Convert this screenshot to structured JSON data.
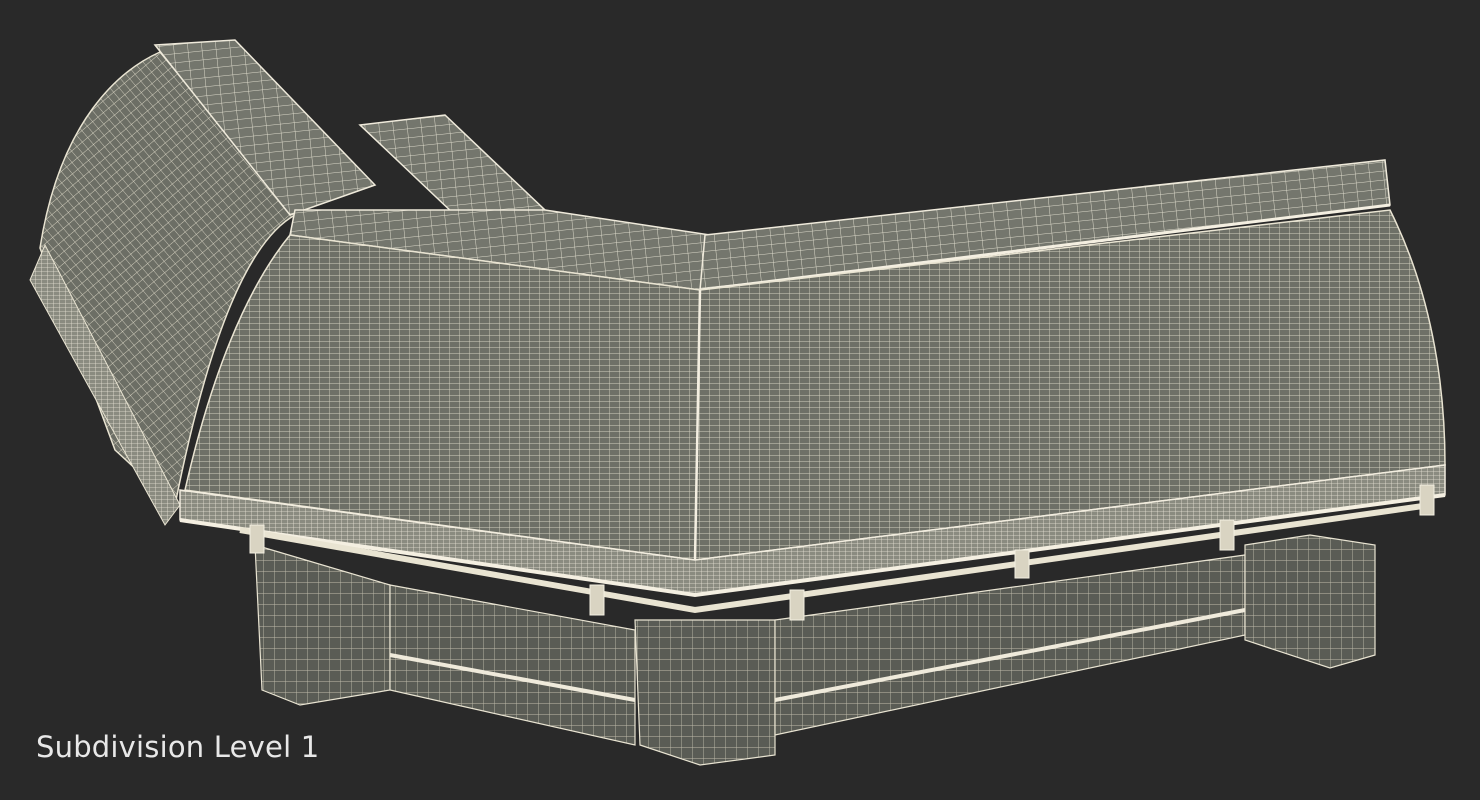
{
  "caption": "Subdivision Level 1",
  "colors": {
    "background": "#292929",
    "mesh_fill": "#6d6f66",
    "mesh_fill_dark": "#4e5049",
    "wire": "#e9e4d2",
    "caption_text": "#e8e8e8"
  }
}
